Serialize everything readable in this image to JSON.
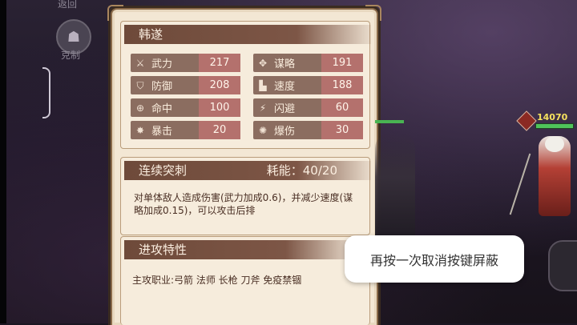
{
  "nav": {
    "back_label": "返回",
    "counter_label": "克制"
  },
  "unit_name": "韩遂",
  "stats": [
    {
      "icon": "sword-icon",
      "label": "武力",
      "value": "217"
    },
    {
      "icon": "strategy-icon",
      "label": "谋略",
      "value": "191"
    },
    {
      "icon": "shield-icon",
      "label": "防御",
      "value": "208"
    },
    {
      "icon": "boot-icon",
      "label": "速度",
      "value": "188"
    },
    {
      "icon": "crosshair-icon",
      "label": "命中",
      "value": "100"
    },
    {
      "icon": "dodge-icon",
      "label": "闪避",
      "value": "60"
    },
    {
      "icon": "crit-icon",
      "label": "暴击",
      "value": "20"
    },
    {
      "icon": "crit-damage-icon",
      "label": "爆伤",
      "value": "30"
    }
  ],
  "skill": {
    "name": "连续突刺",
    "cost": "耗能：40/20",
    "description": "对单体敌人造成伤害(武力加成0.6)，并减少速度(谋略加成0.15)，可以攻击后排"
  },
  "traits": {
    "title": "进攻特性",
    "text": "主攻职业:弓箭 法师 长枪 刀斧 免疫禁锢"
  },
  "battle": {
    "enemy_hp": "14070"
  },
  "toast": "再按一次取消按键屏蔽",
  "colors": {
    "panel_bg": "#f3e7d4",
    "header_bg": "#6e4a3a",
    "stat_bg": "#8b6d60",
    "stat_value_bg": "#b4716d"
  }
}
